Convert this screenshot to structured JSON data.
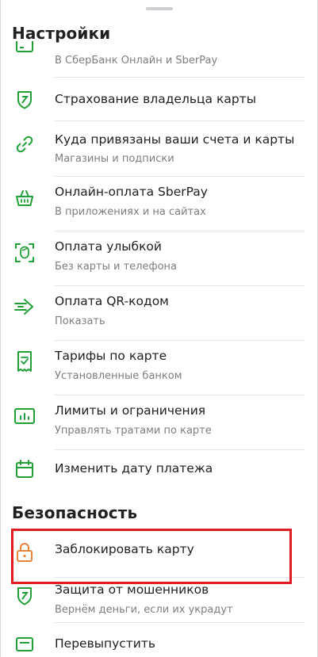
{
  "colors": {
    "accent_green": "#21a038",
    "lock_orange": "#e8833a",
    "highlight_red": "#e01b22",
    "subtitle_gray": "#7e7e82"
  },
  "settings": {
    "title": "Настройки",
    "items": [
      {
        "icon": "card-icon",
        "title": "",
        "subtitle": "В СберБанк Онлайн и SberPay"
      },
      {
        "icon": "shield-icon",
        "title": "Страхование владельца карты",
        "subtitle": ""
      },
      {
        "icon": "link-icon",
        "title": "Куда привязаны ваши счета и карты",
        "subtitle": "Магазины и подписки"
      },
      {
        "icon": "basket-icon",
        "title": "Онлайн-оплата SberPay",
        "subtitle": "В приложениях и на сайтах"
      },
      {
        "icon": "face-scan-icon",
        "title": "Оплата улыбкой",
        "subtitle": "Без карты и телефона"
      },
      {
        "icon": "arrow-right-icon",
        "title": "Оплата QR-кодом",
        "subtitle": "Показать"
      },
      {
        "icon": "document-icon",
        "title": "Тарифы по карте",
        "subtitle": "Установленные банком"
      },
      {
        "icon": "chart-icon",
        "title": "Лимиты и ограничения",
        "subtitle": "Управлять тратами по карте"
      },
      {
        "icon": "calendar-icon",
        "title": "Изменить дату платежа",
        "subtitle": ""
      }
    ]
  },
  "security": {
    "title": "Безопасность",
    "items": [
      {
        "icon": "lock-icon",
        "title": "Заблокировать карту",
        "subtitle": ""
      },
      {
        "icon": "shield-icon",
        "title": "Защита от мошенников",
        "subtitle": "Вернём деньги, если их украдут"
      },
      {
        "icon": "reissue-icon",
        "title": "Перевыпустить",
        "subtitle": ""
      }
    ]
  }
}
